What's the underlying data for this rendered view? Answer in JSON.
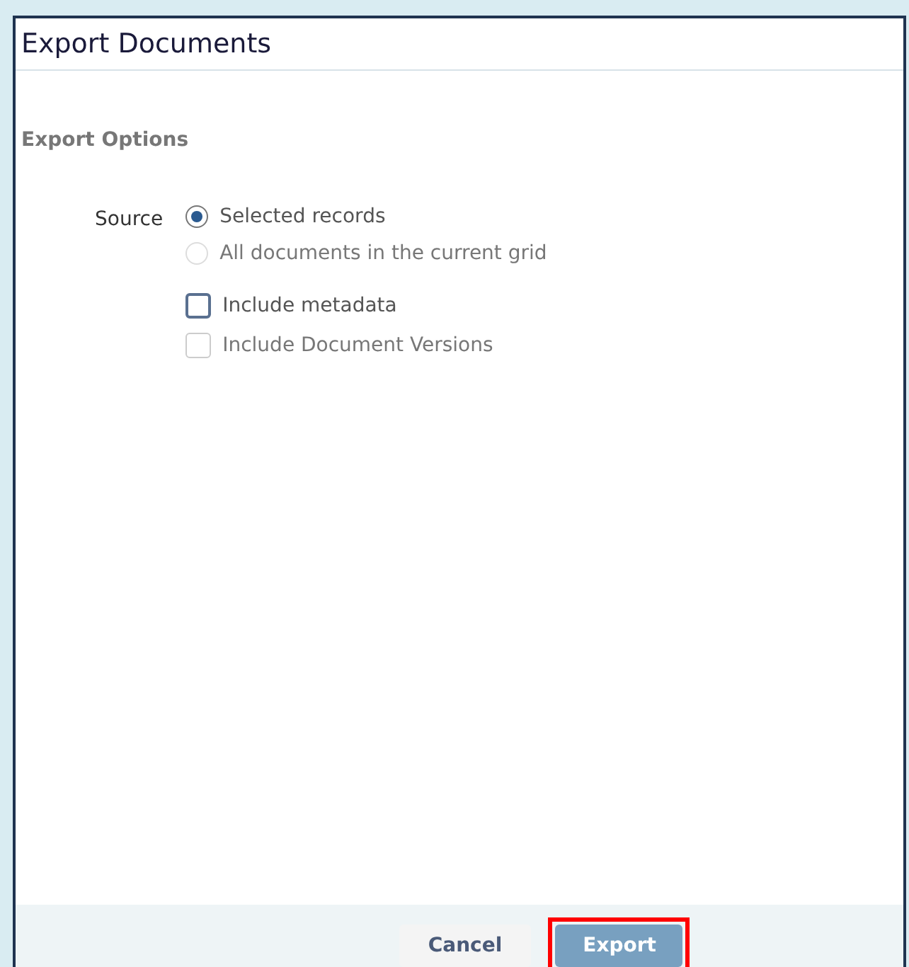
{
  "dialog": {
    "title": "Export Documents"
  },
  "section_title": "Export Options",
  "source": {
    "label": "Source",
    "options": [
      {
        "label": "Selected records",
        "selected": true,
        "disabled": false
      },
      {
        "label": "All documents in the current grid",
        "selected": false,
        "disabled": true
      }
    ]
  },
  "checkboxes": [
    {
      "label": "Include metadata",
      "checked": false,
      "disabled": false
    },
    {
      "label": "Include Document Versions",
      "checked": false,
      "disabled": true
    }
  ],
  "buttons": [
    {
      "label": "Cancel",
      "kind": "secondary",
      "highlighted": false
    },
    {
      "label": "Export",
      "kind": "primary",
      "highlighted": true
    }
  ]
}
